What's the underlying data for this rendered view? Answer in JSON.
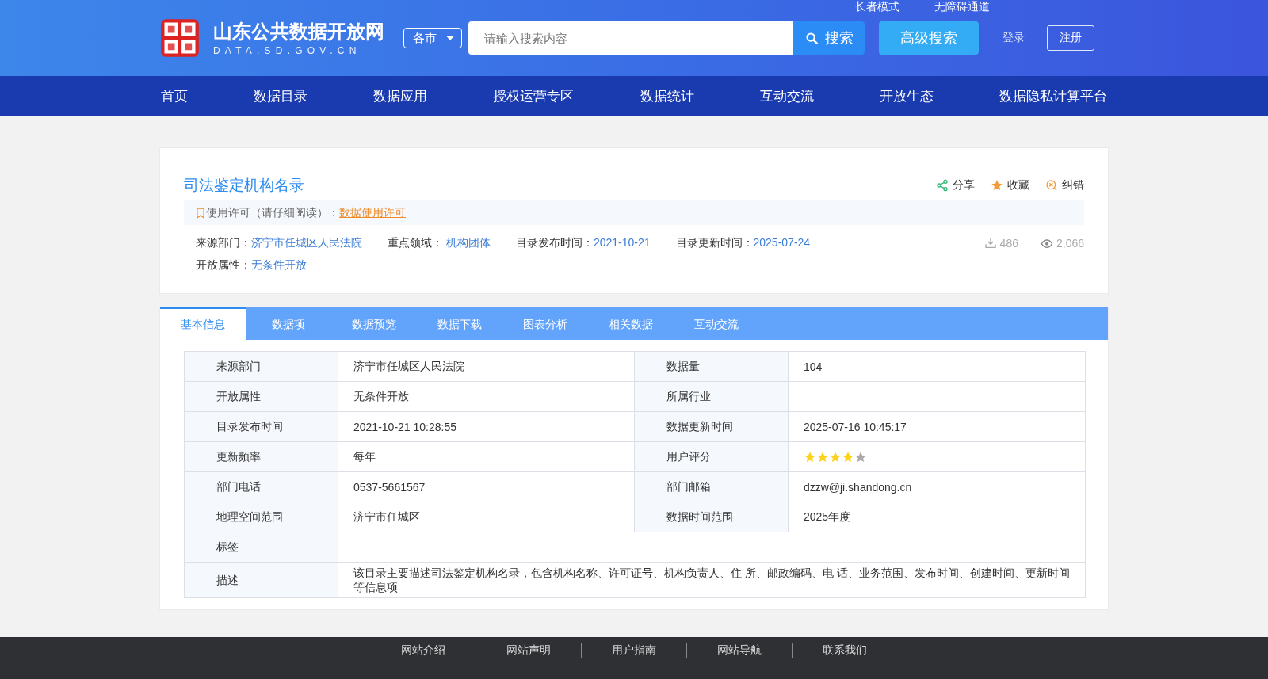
{
  "header": {
    "site_name": "山东公共数据开放网",
    "site_domain": "DATA.SD.GOV.CN",
    "top_links": [
      "长者模式",
      "无障碍通道"
    ],
    "city_select": "各市",
    "search": {
      "placeholder": "请输入搜索内容",
      "button": "搜索"
    },
    "advanced_search": "高级搜索",
    "login": "登录",
    "register": "注册"
  },
  "nav": [
    "首页",
    "数据目录",
    "数据应用",
    "授权运营专区",
    "数据统计",
    "互动交流",
    "开放生态",
    "数据隐私计算平台"
  ],
  "dataset": {
    "title": "司法鉴定机构名录",
    "actions": [
      {
        "kind": "share",
        "label": "分享"
      },
      {
        "kind": "favorite",
        "label": "收藏"
      },
      {
        "kind": "report",
        "label": "纠错"
      }
    ],
    "license": {
      "label": "使用许可（请仔细阅读）：",
      "link": "数据使用许可"
    },
    "meta": [
      [
        {
          "label": "来源部门：",
          "value": "济宁市任城区人民法院"
        },
        {
          "label": "重点领域： ",
          "value": "机构团体"
        },
        {
          "label": "目录发布时间：",
          "value": "2021-10-21"
        },
        {
          "label": "目录更新时间：",
          "value": "2025-07-24"
        }
      ],
      [
        {
          "label": "开放属性：",
          "value": "无条件开放"
        }
      ]
    ],
    "stats": [
      {
        "kind": "downloads",
        "value": "486"
      },
      {
        "kind": "views",
        "value": "2,066"
      }
    ]
  },
  "tabs": [
    {
      "label": "基本信息",
      "selected": true
    },
    {
      "label": "数据项",
      "selected": false
    },
    {
      "label": "数据预览",
      "selected": false
    },
    {
      "label": "数据下载",
      "selected": false
    },
    {
      "label": "图表分析",
      "selected": false
    },
    {
      "label": "相关数据",
      "selected": false
    },
    {
      "label": "互动交流",
      "selected": false
    }
  ],
  "table": {
    "rows": [
      {
        "cells": [
          {
            "label": "来源部门",
            "value": "济宁市任城区人民法院"
          },
          {
            "label": "数据量",
            "value": "104"
          }
        ]
      },
      {
        "cells": [
          {
            "label": "开放属性",
            "value": "无条件开放"
          },
          {
            "label": "所属行业"
          }
        ]
      },
      {
        "cells": [
          {
            "label": "目录发布时间",
            "value": "2021-10-21 10:28:55"
          },
          {
            "label": "数据更新时间",
            "value": "2025-07-16 10:45:17"
          }
        ]
      },
      {
        "cells": [
          {
            "label": "更新频率",
            "value": "每年"
          },
          {
            "label": "用户评分",
            "stars": 4
          }
        ]
      },
      {
        "cells": [
          {
            "label": "部门电话",
            "value": "0537-5661567"
          },
          {
            "label": "部门邮箱",
            "value": "dzzw@ji.shandong.cn"
          }
        ]
      },
      {
        "cells": [
          {
            "label": "地理空间范围",
            "value": "济宁市任城区"
          },
          {
            "label": "数据时间范围",
            "value": "2025年度"
          }
        ]
      },
      {
        "cells": [
          {
            "label": "标签"
          }
        ]
      },
      {
        "cells": [
          {
            "label": "描述",
            "value": "该目录主要描述司法鉴定机构名录，包含机构名称、许可证号、机构负责人、住 所、邮政编码、电 话、业务范围、发布时间、创建时间、更新时间等信息项"
          }
        ]
      }
    ]
  },
  "footer": [
    "网站介绍",
    "网站声明",
    "用户指南",
    "网站导航",
    "联系我们"
  ]
}
